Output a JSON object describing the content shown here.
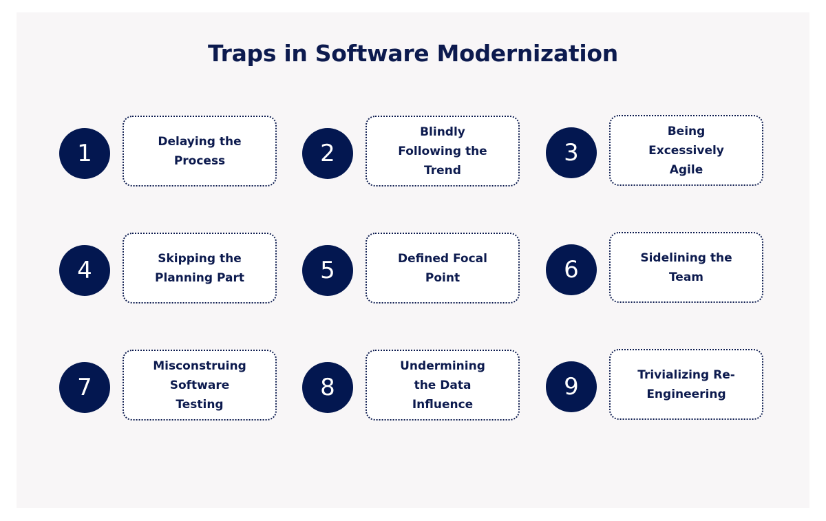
{
  "title": "Traps in Software Modernization",
  "colors": {
    "primary": "#031750",
    "text": "#0c1a4e",
    "panel_bg": "#f8f6f7"
  },
  "items": [
    {
      "number": "1",
      "label": "Delaying the Process"
    },
    {
      "number": "2",
      "label": "Blindly Following the Trend"
    },
    {
      "number": "3",
      "label": "Being Excessively Agile"
    },
    {
      "number": "4",
      "label": "Skipping the Planning Part"
    },
    {
      "number": "5",
      "label": "Defined Focal Point"
    },
    {
      "number": "6",
      "label": "Sidelining the Team"
    },
    {
      "number": "7",
      "label": "Misconstruing Software Testing"
    },
    {
      "number": "8",
      "label": "Undermining the Data Influence"
    },
    {
      "number": "9",
      "label": "Trivializing Re-Engineering"
    }
  ]
}
